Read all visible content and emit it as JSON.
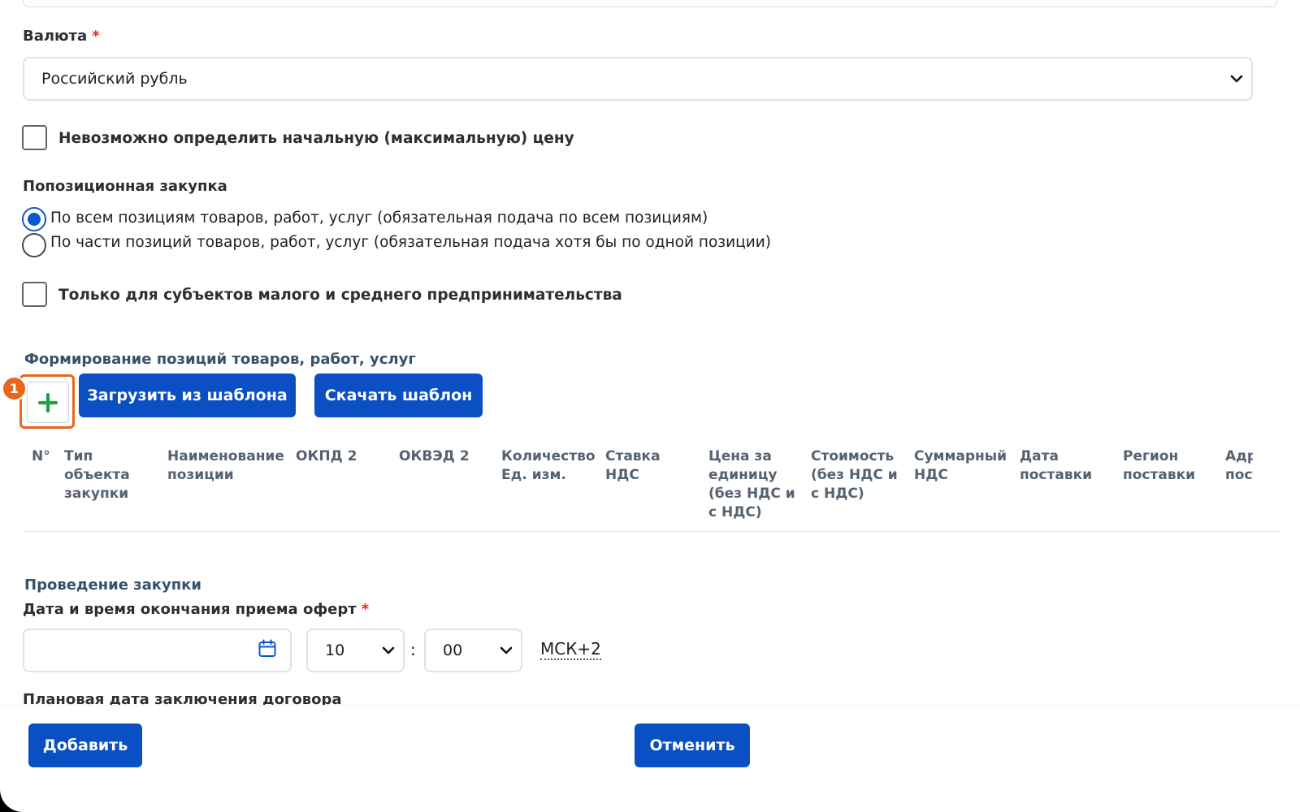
{
  "currency": {
    "label": "Валюта",
    "required_mark": "*",
    "value": "Российский рубль"
  },
  "no_max_price": {
    "label": "Невозможно определить начальную (максимальную) цену",
    "checked": false
  },
  "position_purchase": {
    "label": "Попозиционная закупка",
    "options": [
      {
        "label": "По всем позициям товаров, работ, услуг (обязательная подача по всем позициям)",
        "checked": true
      },
      {
        "label": "По части позиций товаров, работ, услуг (обязательная подача хотя бы по одной позиции)",
        "checked": false
      }
    ]
  },
  "sme_only": {
    "label": "Только для субъектов малого и среднего предпринимательства",
    "checked": false
  },
  "positions_section": {
    "title": "Формирование позиций товаров, работ, услуг",
    "add_icon": "plus-icon",
    "marker": "1",
    "load_template": "Загрузить из шаблона",
    "download_template": "Скачать шаблон",
    "columns": [
      "N°",
      "Тип\nобъекта\nзакупки",
      "Наименование\nпозиции",
      "ОКПД 2",
      "ОКВЭД 2",
      "Количество\nЕд. изм.",
      "Ставка\nНДС",
      "Цена за\nединицу\n(без НДС и\nс НДС)",
      "Стоимость\n(без НДС и\nс НДС)",
      "Суммарный\nНДС",
      "Дата\nпоставки",
      "Регион\nпоставки",
      "Адрес\nпоставки"
    ]
  },
  "procurement": {
    "title": "Проведение закупки",
    "deadline_label": "Дата и время окончания приема оферт",
    "required_mark": "*",
    "date_value": "",
    "calendar_icon": "calendar-icon",
    "hour": "10",
    "separator": ":",
    "minute": "00",
    "timezone": "МСК+2",
    "contract_date_label": "Плановая дата заключения договора"
  },
  "footer": {
    "add_button": "Добавить",
    "cancel_button": "Отменить"
  },
  "colors": {
    "primary": "#0b4fc4",
    "accent": "#e8661e",
    "required": "#d93025",
    "plus": "#22a045"
  }
}
